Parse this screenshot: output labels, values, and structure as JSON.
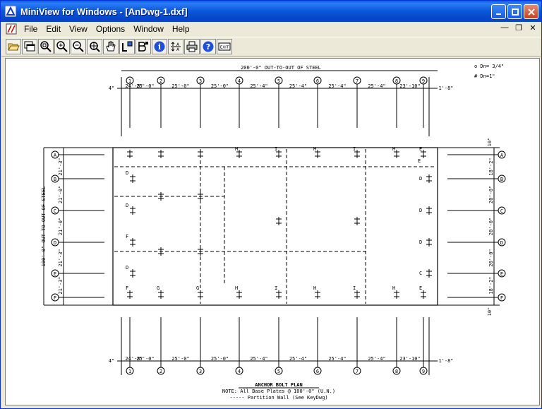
{
  "window": {
    "title": "MiniView for Windows - [AnDwg-1.dxf]"
  },
  "menu": [
    "File",
    "Edit",
    "View",
    "Options",
    "Window",
    "Help"
  ],
  "toolbar": [
    "open-icon",
    "windows-icon",
    "zoom-window-icon",
    "zoom-in-icon",
    "zoom-out-icon",
    "zoom-extents-icon",
    "pan-icon",
    "layers-icon",
    "blocks-icon",
    "info-icon",
    "text-size-icon",
    "print-icon",
    "help-icon",
    "exit-icon"
  ],
  "toolbar_exit_label": "EXIT",
  "drawing": {
    "top_overall": "200'-0\" OUT-TO-OUT OF STEEL",
    "side_overall": "100'-0\" OUT-TO-OUT OF STEEL",
    "legend": [
      "o Dn= 3/4\"",
      "# Dn=1\""
    ],
    "grid_numbers": [
      "1",
      "2",
      "3",
      "4",
      "5",
      "6",
      "7",
      "8",
      "9"
    ],
    "grid_letters": [
      "A",
      "B",
      "C",
      "D",
      "E",
      "F"
    ],
    "bay_dims": [
      "24'-8\"",
      "25'-0\"",
      "25'-0\"",
      "25'-0\"",
      "25'-4\"",
      "25'-4\"",
      "25'-4\"",
      "25'-4\"",
      "23'-10\""
    ],
    "end_dim_left": "4\"",
    "end_dim_right": "1'-8\"",
    "left_dims": [
      "21'-3\"",
      "21'-0\"",
      "21'-0\"",
      "21'-3\"",
      "21'-3\""
    ],
    "right_dims": [
      "18'-2\"",
      "20'-0\"",
      "20'-0\"",
      "20'-0\"",
      "18'-2\""
    ],
    "right_edge_dim": "10\"",
    "title": "ANCHOR BOLT PLAN",
    "note": "NOTE: All Base Plates @ 100'-0\" (U.N.)",
    "partition": "----- Partition Wall (See KeyDwg)",
    "marks": [
      "A",
      "B",
      "C",
      "D",
      "E",
      "F",
      "G",
      "H",
      "I",
      "J",
      "K",
      "L",
      "M",
      "N"
    ]
  }
}
